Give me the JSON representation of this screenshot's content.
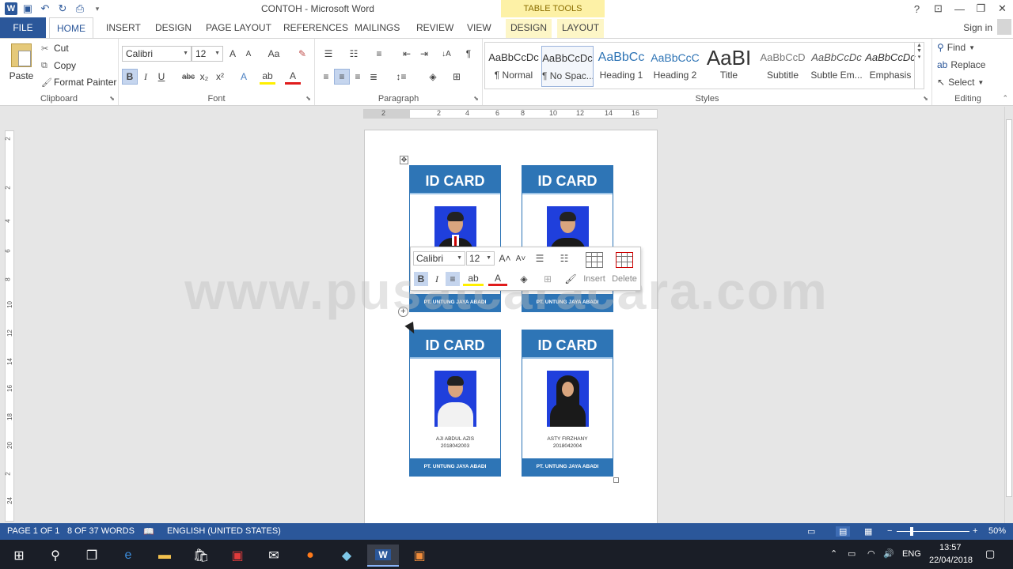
{
  "window": {
    "title": "CONTOH - Microsoft Word",
    "context_tab_group": "TABLE TOOLS",
    "help": "?",
    "minimize": "—",
    "restore": "❐",
    "close": "✕"
  },
  "tabs": [
    "FILE",
    "HOME",
    "INSERT",
    "DESIGN",
    "PAGE LAYOUT",
    "REFERENCES",
    "MAILINGS",
    "REVIEW",
    "VIEW",
    "DESIGN",
    "LAYOUT"
  ],
  "account": {
    "sign_in": "Sign in"
  },
  "ribbon": {
    "clipboard": {
      "label": "Clipboard",
      "paste": "Paste",
      "cut": "Cut",
      "copy": "Copy",
      "format_painter": "Format Painter"
    },
    "font": {
      "label": "Font",
      "font_name": "Calibri",
      "font_size": "12",
      "grow": "A",
      "shrink": "A",
      "case": "Aa",
      "bold": "B",
      "italic": "I",
      "underline": "U",
      "strike": "abc",
      "subscript": "x₂",
      "superscript": "x²",
      "text_effects": "A",
      "highlight": "ab",
      "font_color": "A"
    },
    "paragraph": {
      "label": "Paragraph",
      "pilcrow": "¶",
      "sort": "↓A"
    },
    "styles": {
      "label": "Styles",
      "items": [
        {
          "preview": "AaBbCcDc",
          "name": "¶ Normal"
        },
        {
          "preview": "AaBbCcDc",
          "name": "¶ No Spac..."
        },
        {
          "preview": "AaBbCc",
          "name": "Heading 1"
        },
        {
          "preview": "AaBbCcC",
          "name": "Heading 2"
        },
        {
          "preview": "AaBI",
          "name": "Title"
        },
        {
          "preview": "AaBbCcD",
          "name": "Subtitle"
        },
        {
          "preview": "AaBbCcDc",
          "name": "Subtle Em..."
        },
        {
          "preview": "AaBbCcDc",
          "name": "Emphasis"
        }
      ]
    },
    "editing": {
      "label": "Editing",
      "find": "Find",
      "replace": "Replace",
      "select": "Select"
    }
  },
  "ruler": {
    "h_numbers": [
      "2",
      "2",
      "4",
      "6",
      "8",
      "10",
      "12",
      "14",
      "16"
    ],
    "v_numbers": [
      "2",
      "2",
      "4",
      "6",
      "8",
      "10",
      "12",
      "14",
      "16",
      "18",
      "20",
      "2",
      "24"
    ]
  },
  "cards": [
    {
      "title": "ID CARD",
      "name": "",
      "id": "",
      "company": "PT. UNTUNG JAYA ABADI",
      "person": "male-red-tie"
    },
    {
      "title": "ID CARD",
      "name": "",
      "id": "",
      "company": "PT. UNTUNG JAYA ABADI",
      "person": "male-black"
    },
    {
      "title": "ID CARD",
      "name": "AJI ABDUL AZIS",
      "id": "2018042003",
      "company": "PT. UNTUNG JAYA ABADI",
      "person": "male-white"
    },
    {
      "title": "ID CARD",
      "name": "ASTY FIRZHANY",
      "id": "2018042004",
      "company": "PT. UNTUNG JAYA ABADI",
      "person": "female-hijab"
    }
  ],
  "mini_toolbar": {
    "font_name": "Calibri",
    "font_size": "12",
    "bold": "B",
    "italic": "I",
    "insert": "Insert",
    "delete": "Delete"
  },
  "watermark": "www.pusatcaracara.com",
  "status": {
    "page": "PAGE 1 OF 1",
    "words": "8 OF 37 WORDS",
    "language": "ENGLISH (UNITED STATES)",
    "zoom": "50%",
    "zoom_minus": "−",
    "zoom_plus": "+"
  },
  "taskbar": {
    "language": "ENG",
    "time": "13:57",
    "date": "22/04/2018"
  },
  "colors": {
    "word_blue": "#2b579a",
    "card_blue": "#2e75b6",
    "table_tools": "#fdf1a6"
  }
}
